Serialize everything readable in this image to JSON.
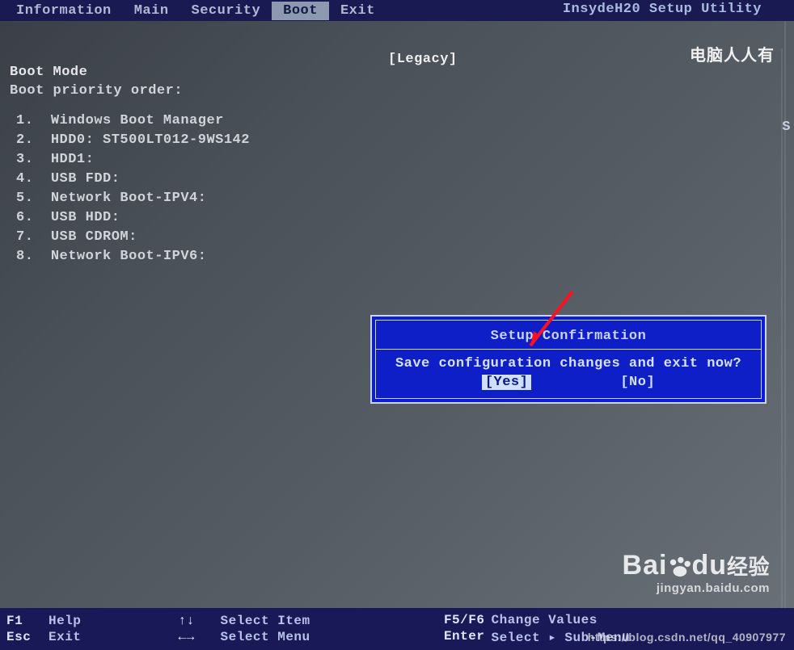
{
  "app": {
    "title": "InsydeH20 Setup Utility"
  },
  "tabs": {
    "information": "Information",
    "main": "Main",
    "security": "Security",
    "boot": "Boot",
    "exit": "Exit",
    "active": "boot"
  },
  "boot": {
    "heading": "Boot Mode",
    "subheading": "Boot priority order:",
    "mode_value": "[Legacy]",
    "items": [
      {
        "num": "1.",
        "label": "Windows Boot Manager"
      },
      {
        "num": "2.",
        "label": "HDD0: ST500LT012-9WS142"
      },
      {
        "num": "3.",
        "label": "HDD1:"
      },
      {
        "num": "4.",
        "label": "USB FDD:"
      },
      {
        "num": "5.",
        "label": "Network Boot-IPV4:"
      },
      {
        "num": "6.",
        "label": "USB HDD:"
      },
      {
        "num": "7.",
        "label": "USB CDROM:"
      },
      {
        "num": "8.",
        "label": "Network Boot-IPV6:"
      }
    ],
    "right_panel_hint_letter": "S"
  },
  "dialog": {
    "title": "Setup Confirmation",
    "message": "Save configuration changes and exit now?",
    "yes": "[Yes]",
    "no": "[No]",
    "selected": "yes"
  },
  "footer": {
    "f1_key": "F1",
    "f1_label": "Help",
    "esc_key": "Esc",
    "esc_label": "Exit",
    "updown_key": "↑↓",
    "updown_label": "Select Item",
    "leftright_key": "←→",
    "leftright_label": "Select Menu",
    "f5f6_key": "F5/F6",
    "f5f6_label": "Change Values",
    "enter_key": "Enter",
    "enter_label": "Select ▸ Sub-Menu"
  },
  "watermarks": {
    "top_right_cn": "电脑人人有",
    "baidu_main": "Bai",
    "baidu_du": "du",
    "baidu_jingyan": "经验",
    "baidu_sub": "jingyan.baidu.com",
    "csdn": "https://blog.csdn.net/qq_40907977"
  }
}
